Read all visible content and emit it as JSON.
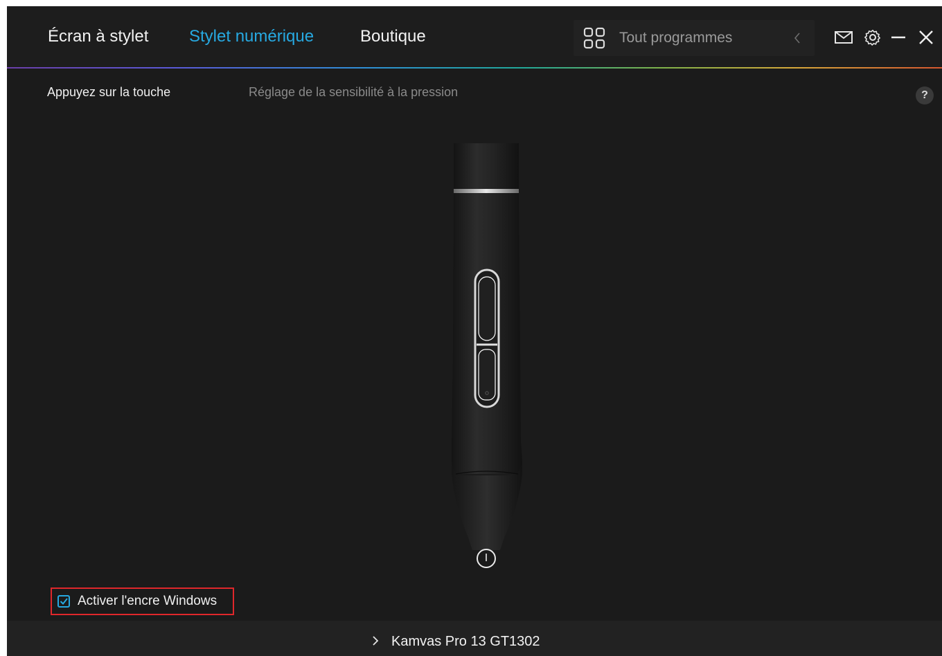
{
  "tabs": {
    "screen": "Écran à stylet",
    "stylus": "Stylet numérique",
    "shop": "Boutique"
  },
  "program_select": {
    "label": "Tout programmes",
    "icon": "grid-icon"
  },
  "window_controls": {
    "icons": [
      "mail-icon",
      "gear-icon",
      "minimize-icon",
      "close-icon"
    ]
  },
  "subtabs": {
    "press_key": "Appuyez sur la touche",
    "pressure": "Réglage de la sensibilité à la pression"
  },
  "help": "?",
  "windows_ink": {
    "label": "Activer l'encre Windows",
    "checked": true
  },
  "device": {
    "name": "Kamvas Pro 13 GT1302"
  },
  "colors": {
    "background": "#1b1b1b",
    "accent": "#27a9e1",
    "highlight_border": "#e0272b"
  }
}
